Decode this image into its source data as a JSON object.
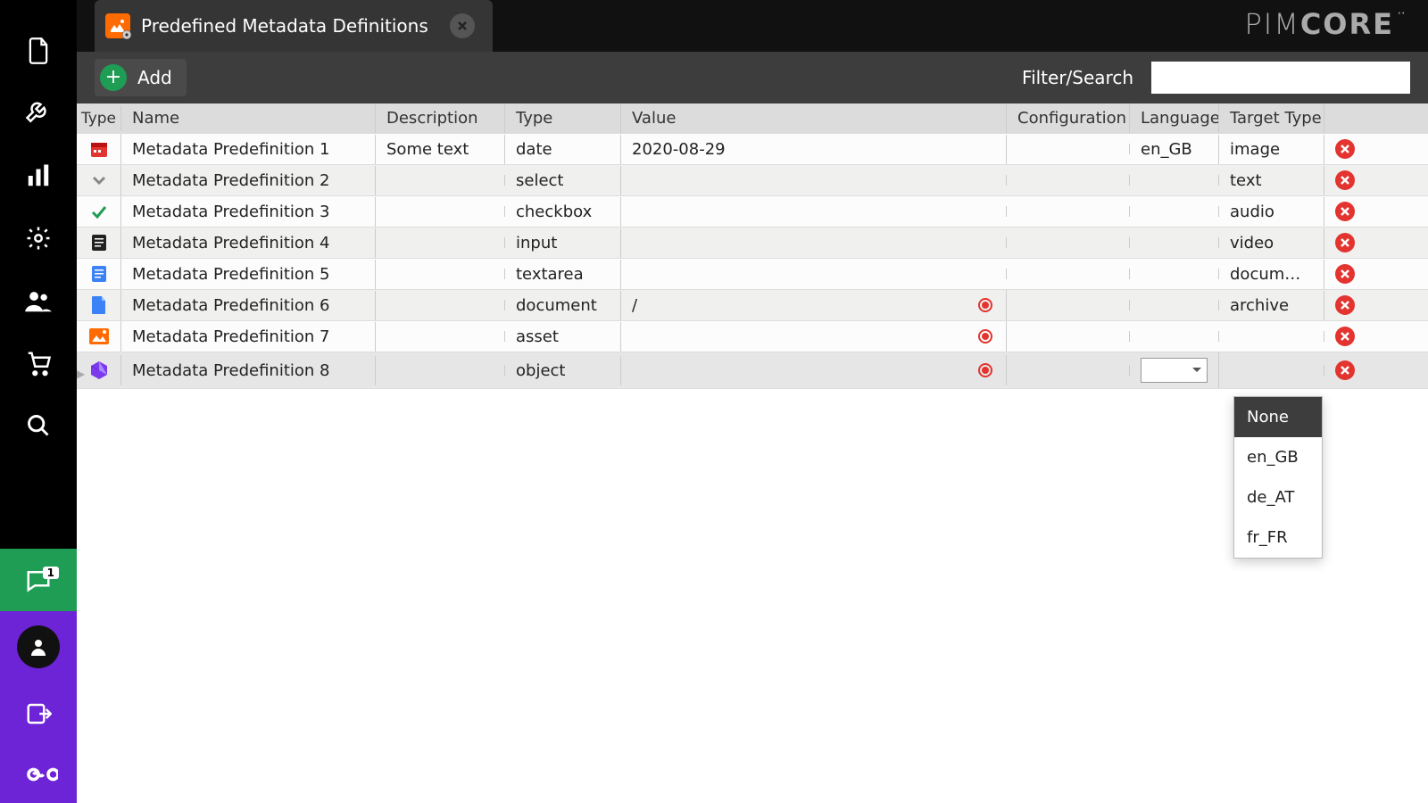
{
  "brand": "PIMCORE",
  "tab": {
    "title": "Predefined Metadata Definitions"
  },
  "toolbar": {
    "add_label": "Add",
    "filter_label": "Filter/Search",
    "filter_value": ""
  },
  "notify_count": "1",
  "columns": {
    "icon": "Type",
    "name": "Name",
    "desc": "Description",
    "type": "Type",
    "value": "Value",
    "config": "Configuration",
    "lang": "Language",
    "target": "Target Type"
  },
  "rows": [
    {
      "icon": "date",
      "name": "Metadata Predefinition 1",
      "desc": "Some text",
      "type": "date",
      "value": "2020-08-29",
      "config": "",
      "lang": "en_GB",
      "target": "image",
      "has_target_dot": false
    },
    {
      "icon": "select",
      "name": "Metadata Predefinition 2",
      "desc": "",
      "type": "select",
      "value": "",
      "config": "",
      "lang": "",
      "target": "text",
      "has_target_dot": false
    },
    {
      "icon": "checkbox",
      "name": "Metadata Predefinition 3",
      "desc": "",
      "type": "checkbox",
      "value": "",
      "config": "",
      "lang": "",
      "target": "audio",
      "has_target_dot": false
    },
    {
      "icon": "input",
      "name": "Metadata Predefinition 4",
      "desc": "",
      "type": "input",
      "value": "",
      "config": "",
      "lang": "",
      "target": "video",
      "has_target_dot": false
    },
    {
      "icon": "textarea",
      "name": "Metadata Predefinition 5",
      "desc": "",
      "type": "textarea",
      "value": "",
      "config": "",
      "lang": "",
      "target": "docum…",
      "has_target_dot": false
    },
    {
      "icon": "document",
      "name": "Metadata Predefinition 6",
      "desc": "",
      "type": "document",
      "value": "/",
      "config": "",
      "lang": "",
      "target": "archive",
      "has_target_dot": true
    },
    {
      "icon": "asset",
      "name": "Metadata Predefinition 7",
      "desc": "",
      "type": "asset",
      "value": "",
      "config": "",
      "lang": "",
      "target": "",
      "has_target_dot": true
    },
    {
      "icon": "object",
      "name": "Metadata Predefinition 8",
      "desc": "",
      "type": "object",
      "value": "",
      "config": "",
      "lang": "",
      "target": "",
      "has_target_dot": true,
      "active": true
    }
  ],
  "language_dropdown": {
    "options": [
      "None",
      "en_GB",
      "de_AT",
      "fr_FR"
    ],
    "selected": "None"
  }
}
